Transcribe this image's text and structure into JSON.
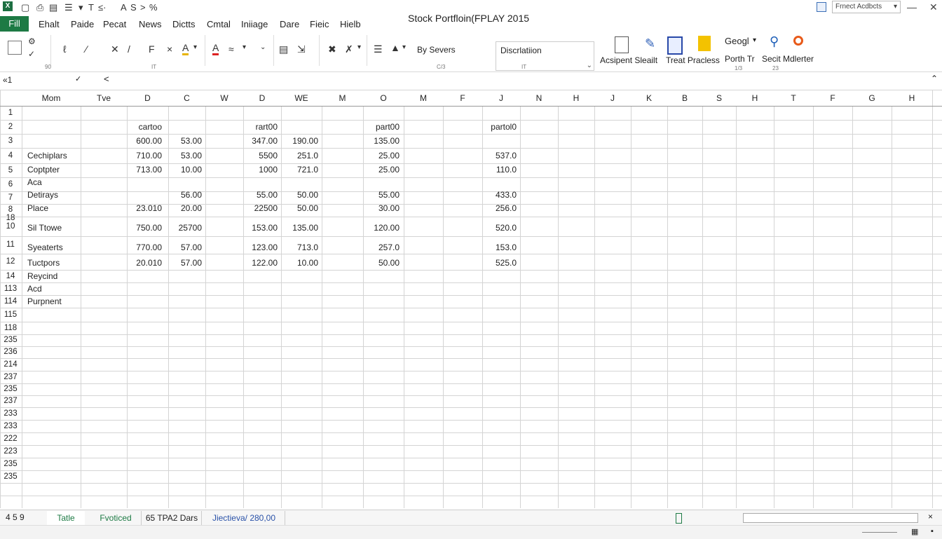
{
  "window": {
    "title": "Stock Portfloin(FPLAY 2015",
    "quick_access": [
      "T",
      "≤·",
      "A",
      "S",
      ">",
      "%"
    ],
    "account": "Frnect Acdbcts",
    "minimize": "—",
    "close": "✕"
  },
  "menubar": {
    "file": "Fill",
    "items": [
      "Ehalt",
      "Paide",
      "Pecat",
      "News",
      "Dictts",
      "Cmtal",
      "Iniiage",
      "Dare",
      "Fieic",
      "Hielb"
    ]
  },
  "ribbon": {
    "by_label": "By Severs",
    "discription": "Discrlatiion",
    "acsipent": "Acsipent Sleailt",
    "treat": "Treat Pracless",
    "google": "Geogl",
    "porth": "Porth Tr",
    "secit": "Secit Mdlerter",
    "tiny_labels": [
      "90",
      "IT",
      "C/3",
      "IT",
      "1/3",
      "23"
    ]
  },
  "formula_bar": {
    "name_box": "«1",
    "content": "<"
  },
  "grid": {
    "col_headers": [
      "Mom",
      "Tve",
      "D",
      "C",
      "W",
      "D",
      "WE",
      "M",
      "O",
      "M",
      "F",
      "J",
      "N",
      "H",
      "J",
      "K",
      "B",
      "S",
      "H",
      "T",
      "F",
      "G",
      "H"
    ],
    "row_headers": [
      "1",
      "2",
      "3",
      "4",
      "5",
      "6",
      "7",
      "8\n18",
      "10",
      "11",
      "12",
      "14",
      "113",
      "114",
      "115",
      "118",
      "235",
      "236",
      "214",
      "237",
      "235",
      "237",
      "233",
      "233",
      "222",
      "223",
      "235",
      "235"
    ],
    "names": {
      "r4": "Cechiplars",
      "r5": "Coptpter",
      "r5b": "Aca",
      "r6": "Detirays",
      "r7": "Place",
      "r18": "Sil Ttowe",
      "r10": "Syeaterts",
      "r11": "Tuctpors",
      "r12": "Reycind",
      "r14": "Acd",
      "r113": "Purpnent"
    },
    "groups": {
      "g1": "cartoo",
      "g2": "rart00",
      "g3": "part00",
      "g4": "partol0"
    },
    "rows": {
      "r3": [
        "600.00",
        "53.00",
        "347.00",
        "190.00",
        "135.00",
        ""
      ],
      "r4": [
        "710.00",
        "53.00",
        "5500",
        "251.0",
        "25.00",
        "537.0"
      ],
      "r5": [
        "713.00",
        "10.00",
        "1000",
        "721.0",
        "25.00",
        "110.0"
      ],
      "r6": [
        "",
        "56.00",
        "55.00",
        "50.00",
        "55.00",
        "433.0"
      ],
      "r7": [
        "23.010",
        "20.00",
        "22500",
        "50.00",
        "30.00",
        "256.0"
      ],
      "r18": [
        "750.00",
        "25700",
        "153.00",
        "135.00",
        "120.00",
        "520.0"
      ],
      "r10": [
        "770.00",
        "57.00",
        "123.00",
        "713.0",
        "257.0",
        "153.0"
      ],
      "r11": [
        "20.010",
        "57.00",
        "122.00",
        "10.00",
        "50.00",
        "525.0"
      ]
    }
  },
  "sheet_tabs": {
    "nav": "4  5  9",
    "tabs": [
      "Tatle",
      "Fvoticed",
      "65 TPA2 Dars",
      "Jiectieva/ 280,00"
    ]
  }
}
